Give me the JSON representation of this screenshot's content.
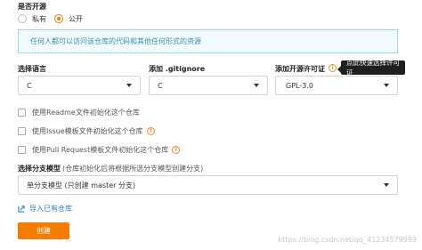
{
  "open_source": {
    "label": "是否开源",
    "options": [
      {
        "label": "私有",
        "selected": false
      },
      {
        "label": "公开",
        "selected": true
      }
    ]
  },
  "info_notice": "任何人都可以访问该仓库的代码和其他任何形式的资源",
  "language": {
    "label": "选择语言",
    "value": "C"
  },
  "gitignore": {
    "label": "添加 .gitignore",
    "value": "C"
  },
  "license": {
    "label": "添加开源许可证",
    "value": "GPL-3.0",
    "tooltip": "点此快速选择许可证"
  },
  "checkboxes": [
    {
      "label": "使用Readme文件初始化这个仓库",
      "checked": false,
      "help": false
    },
    {
      "label": "使用Issue模板文件初始化这个仓库",
      "checked": false,
      "help": true
    },
    {
      "label": "使用Pull Request模板文件初始化这个仓库",
      "checked": false,
      "help": true
    }
  ],
  "branch_model": {
    "label": "选择分支模型",
    "hint": "(仓库初始化后将根据所选分支模型创建分支)",
    "value": "单分支模型 (只创建 master 分支)"
  },
  "import_link": "导入已有仓库",
  "create_button": "创建",
  "watermark": "https://blog.csdn.net/qq_41234579999",
  "colors": {
    "accent": "#f57c00",
    "info_border": "#9fd7e6",
    "info_text": "#3a8fa7",
    "link": "#2f7fc1"
  }
}
